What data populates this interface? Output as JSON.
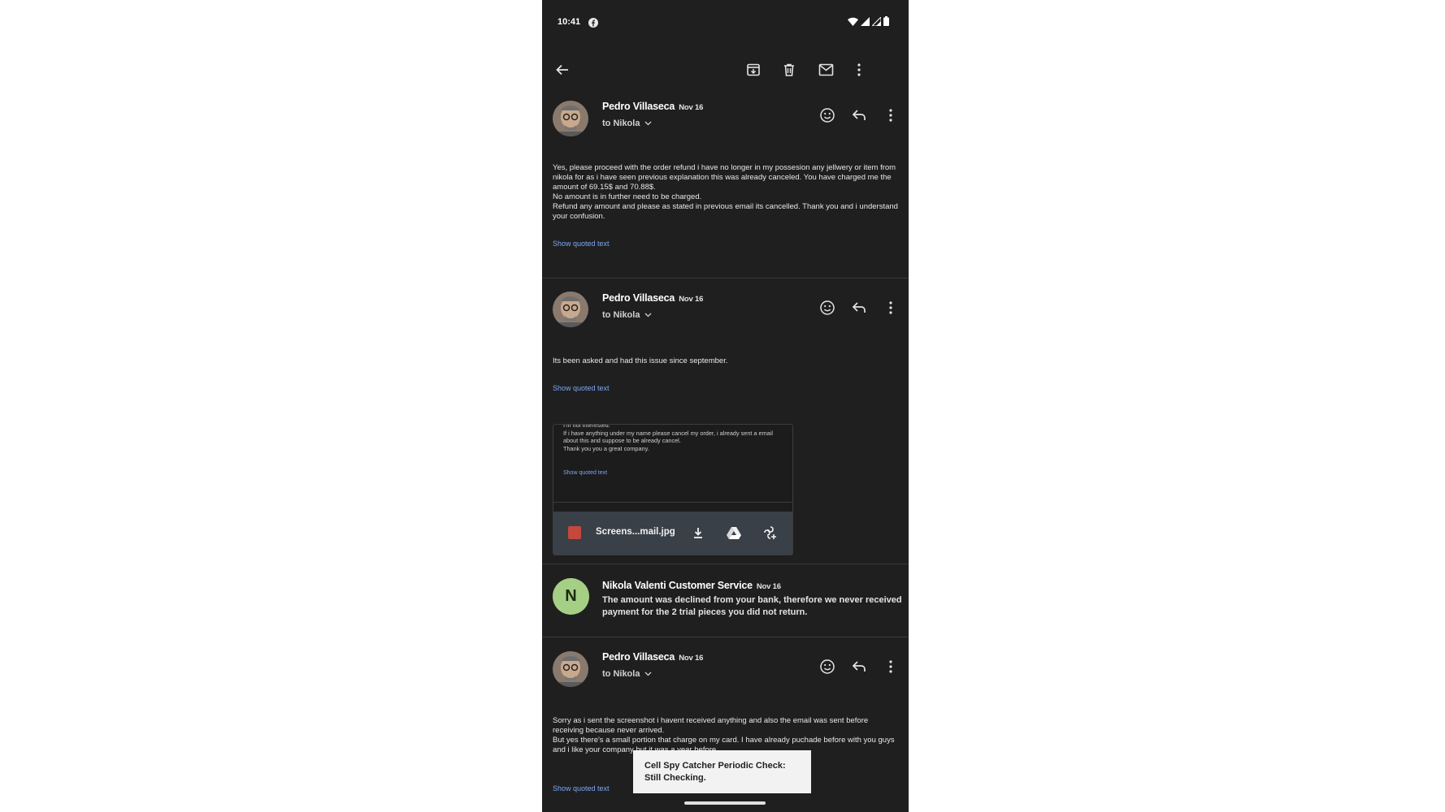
{
  "status_bar": {
    "time": "10:41"
  },
  "messages": [
    {
      "sender": "Pedro Villaseca",
      "date": "Nov 16",
      "recipient": "to Nikola",
      "body": "Yes, please proceed with the order refund i have no longer in my possesion any jellwery or item from nikola for as i have seen previous explanation this was already canceled. You have charged me the amount of 69.15$ and 70.88$.\nNo amount is in further need to be charged.\nRefund any amount and please as stated in previous email its cancelled. Thank you and i understand your confusion.",
      "quoted_link": "Show quoted text"
    },
    {
      "sender": "Pedro Villaseca",
      "date": "Nov 16",
      "recipient": "to Nikola",
      "body": "Its been asked and had this issue since september.",
      "quoted_link": "Show quoted text",
      "attachment": {
        "preview_text": "I'm not interested.\nIf i have anything under my name please cancel my order, i already sent a email about this and suppose to be already cancel.\nThank you you a great company.",
        "preview_quoted_link": "Show quoted text",
        "filename": "Screens...mail.jpg"
      }
    },
    {
      "sender": "Nikola Valenti Customer Service",
      "date": "Nov 16",
      "avatar_letter": "N",
      "snippet": "The amount was declined from your bank, therefore we never received payment for the 2 trial pieces you did not return."
    },
    {
      "sender": "Pedro Villaseca",
      "date": "Nov 16",
      "recipient": "to Nikola",
      "body": "Sorry as i sent the screenshot i havent received anything and also the email was sent before receiving because never arrived.\nBut yes there's a small portion that charge on my card. I have already puchade before with you guys and i like your company but it was a year before.",
      "quoted_link": "Show quoted text"
    }
  ],
  "toast": {
    "text": "Cell Spy Catcher Periodic Check: Still Checking."
  },
  "colors": {
    "background": "#1f1f1f",
    "link": "#7aa8f7",
    "attachment_bar": "#3a4048",
    "nikola_avatar": "#a6cf86"
  },
  "icons": [
    "back-arrow-icon",
    "archive-icon",
    "delete-icon",
    "mark-unread-icon",
    "more-vert-icon",
    "emoji-icon",
    "reply-icon",
    "image-file-icon",
    "download-icon",
    "drive-icon",
    "add-to-photos-icon",
    "wifi-icon",
    "signal-icon",
    "battery-icon"
  ]
}
